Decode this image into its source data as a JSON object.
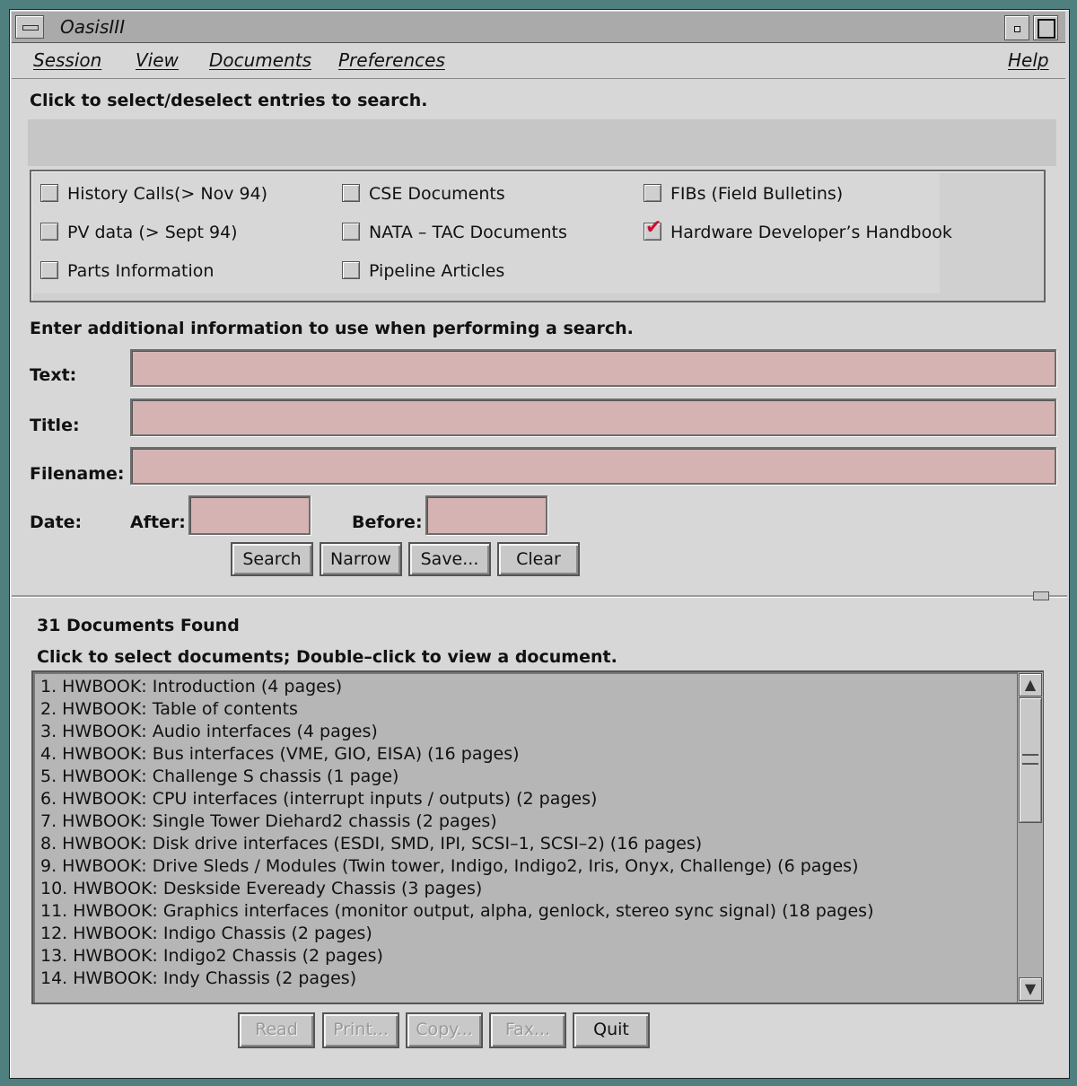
{
  "window": {
    "title": "OasisIII"
  },
  "menubar": {
    "session": "Session",
    "view": "View",
    "documents": "Documents",
    "preferences": "Preferences",
    "help": "Help"
  },
  "select_section": {
    "instruction": "Click to select/deselect entries to search.",
    "checkboxes": [
      {
        "label": "History Calls(> Nov 94)",
        "checked": false
      },
      {
        "label": "PV data (> Sept 94)",
        "checked": false
      },
      {
        "label": "Parts Information",
        "checked": false
      },
      {
        "label": "CSE Documents",
        "checked": false
      },
      {
        "label": "NATA – TAC Documents",
        "checked": false
      },
      {
        "label": "Pipeline Articles",
        "checked": false
      },
      {
        "label": "FIBs (Field Bulletins)",
        "checked": false
      },
      {
        "label": "Hardware Developer’s Handbook",
        "checked": true
      }
    ]
  },
  "search_form": {
    "instruction": "Enter additional information to use when performing a search.",
    "text_label": "Text:",
    "title_label": "Title:",
    "filename_label": "Filename:",
    "date_label": "Date:",
    "after_label": "After:",
    "before_label": "Before:",
    "text_value": "",
    "title_value": "",
    "filename_value": "",
    "after_value": "",
    "before_value": "",
    "buttons": {
      "search": "Search",
      "narrow": "Narrow",
      "save": "Save...",
      "clear": "Clear"
    }
  },
  "results": {
    "count_text": "31 Documents Found",
    "instruction": "Click to select documents; Double–click to view a document.",
    "items": [
      "1.  HWBOOK: Introduction (4 pages)",
      "2.  HWBOOK: Table of contents",
      "3.  HWBOOK: Audio interfaces (4 pages)",
      "4.  HWBOOK: Bus interfaces (VME, GIO, EISA) (16 pages)",
      "5.  HWBOOK: Challenge S chassis (1 page)",
      "6.  HWBOOK: CPU interfaces (interrupt inputs / outputs) (2 pages)",
      "7.  HWBOOK: Single Tower Diehard2 chassis (2 pages)",
      "8.  HWBOOK: Disk drive interfaces (ESDI, SMD, IPI, SCSI–1, SCSI–2) (16 pages)",
      "9.  HWBOOK: Drive Sleds / Modules (Twin tower, Indigo, Indigo2, Iris, Onyx, Challenge) (6 pages)",
      "10.  HWBOOK: Deskside Eveready Chassis (3 pages)",
      "11.  HWBOOK: Graphics interfaces (monitor output, alpha, genlock, stereo sync signal) (18 pages)",
      "12.  HWBOOK: Indigo Chassis (2 pages)",
      "13.  HWBOOK: Indigo2 Chassis (2 pages)",
      "14.  HWBOOK: Indy Chassis (2 pages)"
    ],
    "buttons": {
      "read": "Read",
      "print": "Print...",
      "copy": "Copy...",
      "fax": "Fax...",
      "quit": "Quit"
    }
  }
}
